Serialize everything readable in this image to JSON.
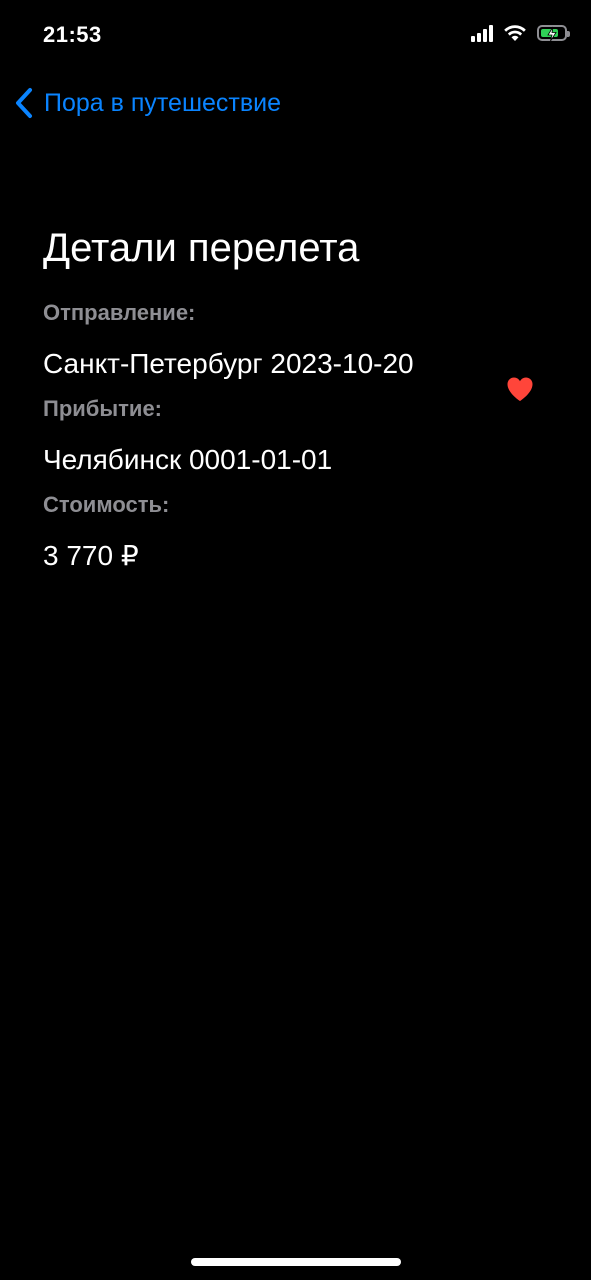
{
  "status_bar": {
    "time": "21:53"
  },
  "nav": {
    "back_label": "Пора в путешествие"
  },
  "details": {
    "title": "Детали перелета",
    "departure_label": "Отправление:",
    "departure_value": "Санкт-Петербург 2023-10-20",
    "arrival_label": "Прибытие:",
    "arrival_value": "Челябинск 0001-01-01",
    "price_label": "Стоимость:",
    "price_value": "3 770 ₽"
  },
  "colors": {
    "background": "#000000",
    "accent": "#0a84ff",
    "secondary_text": "#8e8e93",
    "favorite": "#ff453a",
    "battery_charge": "#30d158"
  },
  "icons": {
    "back": "chevron-left-icon",
    "favorite": "heart-icon",
    "signal": "cellular-signal-icon",
    "wifi": "wifi-icon",
    "battery": "battery-charging-icon"
  },
  "favorite": {
    "active": true
  }
}
